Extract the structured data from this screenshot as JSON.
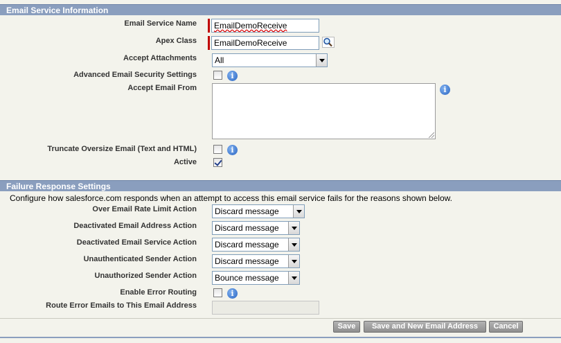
{
  "sections": {
    "email_service": "Email Service Information",
    "failure_response": "Failure Response Settings"
  },
  "fields": {
    "email_service_name": {
      "label": "Email Service Name",
      "value": "EmailDemoReceive"
    },
    "apex_class": {
      "label": "Apex Class",
      "value": "EmailDemoReceive",
      "lookup_icon": "magnifier-lookup-icon"
    },
    "accept_attachments": {
      "label": "Accept Attachments",
      "value": "All"
    },
    "advanced_security": {
      "label": "Advanced Email Security Settings",
      "checked": false
    },
    "accept_email_from": {
      "label": "Accept Email From",
      "value": ""
    },
    "truncate_oversize": {
      "label": "Truncate Oversize Email (Text and HTML)",
      "checked": false
    },
    "active": {
      "label": "Active",
      "checked": true
    }
  },
  "failure": {
    "description": "Configure how salesforce.com responds when an attempt to access this email service fails for the reasons shown below.",
    "over_rate_limit": {
      "label": "Over Email Rate Limit Action",
      "value": "Discard message"
    },
    "deactivated_address": {
      "label": "Deactivated Email Address Action",
      "value": "Discard message"
    },
    "deactivated_service": {
      "label": "Deactivated Email Service Action",
      "value": "Discard message"
    },
    "unauthenticated_sender": {
      "label": "Unauthenticated Sender Action",
      "value": "Discard message"
    },
    "unauthorized_sender": {
      "label": "Unauthorized Sender Action",
      "value": "Bounce message"
    },
    "error_routing": {
      "label": "Enable Error Routing",
      "checked": false
    },
    "route_error_to": {
      "label": "Route Error Emails to This Email Address",
      "value": ""
    }
  },
  "buttons": {
    "save": "Save",
    "save_and_new": "Save and New Email Address",
    "cancel": "Cancel"
  },
  "icons": {
    "info": "i"
  },
  "colors": {
    "section_header": "#8a9ebe",
    "required_bar": "#c00000",
    "page_bg": "#f3f3ec"
  }
}
